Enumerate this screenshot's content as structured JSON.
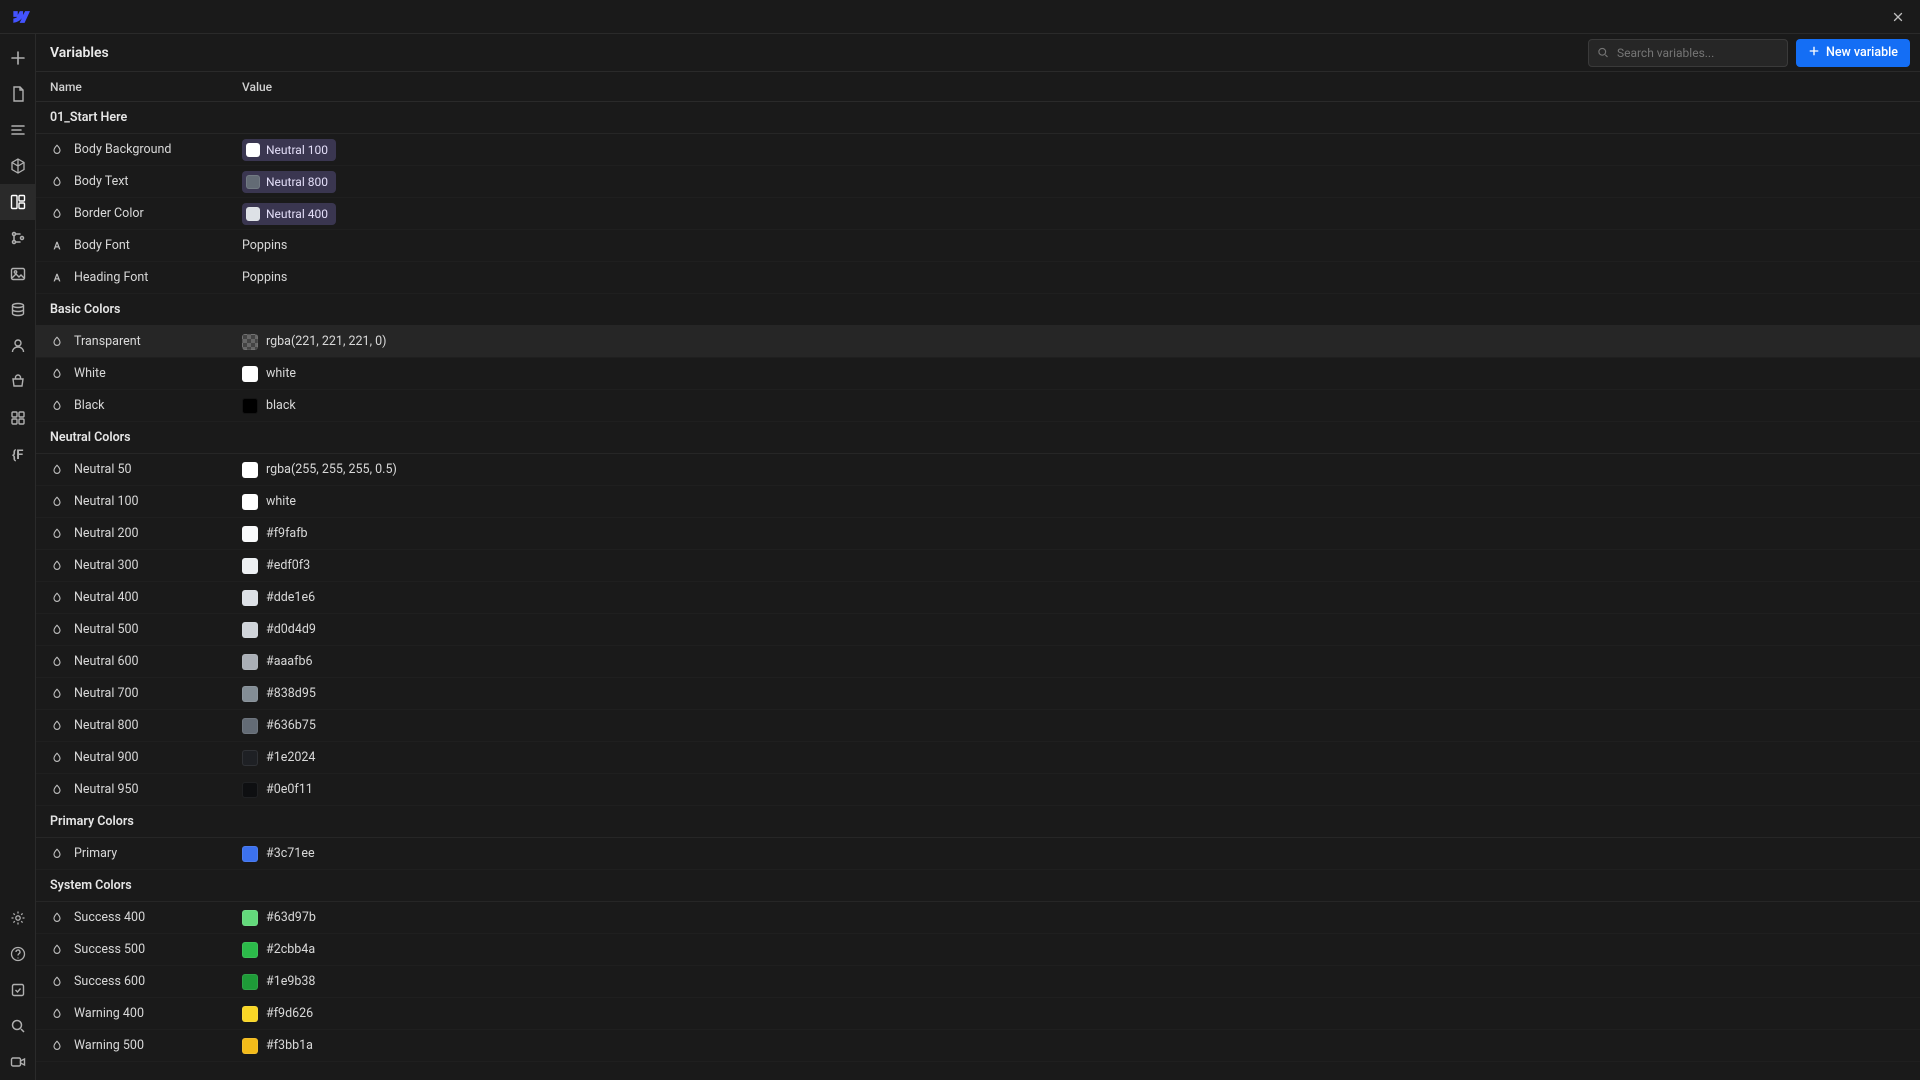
{
  "topbar": {
    "close_tooltip": "Close"
  },
  "rail": {
    "icons": [
      {
        "name": "add-icon"
      },
      {
        "name": "pages-icon"
      },
      {
        "name": "navigator-icon"
      },
      {
        "name": "components-icon"
      },
      {
        "name": "variables-icon",
        "active": true
      },
      {
        "name": "styles-icon"
      },
      {
        "name": "assets-icon"
      },
      {
        "name": "cms-icon"
      },
      {
        "name": "users-icon"
      },
      {
        "name": "ecommerce-icon"
      },
      {
        "name": "apps-icon"
      },
      {
        "name": "find-icon"
      }
    ],
    "bottom_icons": [
      {
        "name": "settings-icon"
      },
      {
        "name": "help-icon"
      },
      {
        "name": "audit-icon"
      },
      {
        "name": "search2-icon"
      },
      {
        "name": "video-icon"
      }
    ]
  },
  "panel": {
    "title": "Variables",
    "search_placeholder": "Search variables...",
    "new_button": "New variable",
    "columns": {
      "name": "Name",
      "value": "Value"
    }
  },
  "groups": [
    {
      "label": "01_Start Here",
      "items": [
        {
          "type": "color",
          "name": "Body Background",
          "value_mode": "token",
          "token_label": "Neutral 100",
          "token_color": "#ffffff"
        },
        {
          "type": "color",
          "name": "Body Text",
          "value_mode": "token",
          "token_label": "Neutral 800",
          "token_color": "#636b75"
        },
        {
          "type": "color",
          "name": "Border Color",
          "value_mode": "token",
          "token_label": "Neutral 400",
          "token_color": "#dde1e6"
        },
        {
          "type": "font",
          "name": "Body Font",
          "value_mode": "text",
          "value_text": "Poppins"
        },
        {
          "type": "font",
          "name": "Heading Font",
          "value_mode": "text",
          "value_text": "Poppins"
        }
      ]
    },
    {
      "label": "Basic Colors",
      "items": [
        {
          "type": "color",
          "name": "Transparent",
          "value_mode": "color",
          "swatch": "checker",
          "value_text": "rgba(221, 221, 221, 0)",
          "highlight": true
        },
        {
          "type": "color",
          "name": "White",
          "value_mode": "color",
          "swatch": "#ffffff",
          "value_text": "white"
        },
        {
          "type": "color",
          "name": "Black",
          "value_mode": "color",
          "swatch": "#000000",
          "value_text": "black"
        }
      ]
    },
    {
      "label": "Neutral Colors",
      "items": [
        {
          "type": "color",
          "name": "Neutral 50",
          "value_mode": "color",
          "swatch": "#ffffff",
          "value_text": "rgba(255, 255, 255, 0.5)"
        },
        {
          "type": "color",
          "name": "Neutral 100",
          "value_mode": "color",
          "swatch": "#ffffff",
          "value_text": "white"
        },
        {
          "type": "color",
          "name": "Neutral 200",
          "value_mode": "color",
          "swatch": "#f9fafb",
          "value_text": "#f9fafb"
        },
        {
          "type": "color",
          "name": "Neutral 300",
          "value_mode": "color",
          "swatch": "#edf0f3",
          "value_text": "#edf0f3"
        },
        {
          "type": "color",
          "name": "Neutral 400",
          "value_mode": "color",
          "swatch": "#dde1e6",
          "value_text": "#dde1e6"
        },
        {
          "type": "color",
          "name": "Neutral 500",
          "value_mode": "color",
          "swatch": "#d0d4d9",
          "value_text": "#d0d4d9"
        },
        {
          "type": "color",
          "name": "Neutral 600",
          "value_mode": "color",
          "swatch": "#aaafb6",
          "value_text": "#aaafb6"
        },
        {
          "type": "color",
          "name": "Neutral 700",
          "value_mode": "color",
          "swatch": "#838d95",
          "value_text": "#838d95"
        },
        {
          "type": "color",
          "name": "Neutral 800",
          "value_mode": "color",
          "swatch": "#636b75",
          "value_text": "#636b75"
        },
        {
          "type": "color",
          "name": "Neutral 900",
          "value_mode": "color",
          "swatch": "#1e2024",
          "value_text": "#1e2024"
        },
        {
          "type": "color",
          "name": "Neutral 950",
          "value_mode": "color",
          "swatch": "#0e0f11",
          "value_text": "#0e0f11"
        }
      ]
    },
    {
      "label": "Primary Colors",
      "items": [
        {
          "type": "color",
          "name": "Primary",
          "value_mode": "color",
          "swatch": "#3c71ee",
          "value_text": "#3c71ee"
        }
      ]
    },
    {
      "label": "System Colors",
      "items": [
        {
          "type": "color",
          "name": "Success 400",
          "value_mode": "color",
          "swatch": "#63d97b",
          "value_text": "#63d97b"
        },
        {
          "type": "color",
          "name": "Success 500",
          "value_mode": "color",
          "swatch": "#2cbb4a",
          "value_text": "#2cbb4a"
        },
        {
          "type": "color",
          "name": "Success 600",
          "value_mode": "color",
          "swatch": "#1e9b38",
          "value_text": "#1e9b38"
        },
        {
          "type": "color",
          "name": "Warning 400",
          "value_mode": "color",
          "swatch": "#f9d626",
          "value_text": "#f9d626"
        },
        {
          "type": "color",
          "name": "Warning 500",
          "value_mode": "color",
          "swatch": "#f3bb1a",
          "value_text": "#f3bb1a"
        }
      ]
    }
  ]
}
